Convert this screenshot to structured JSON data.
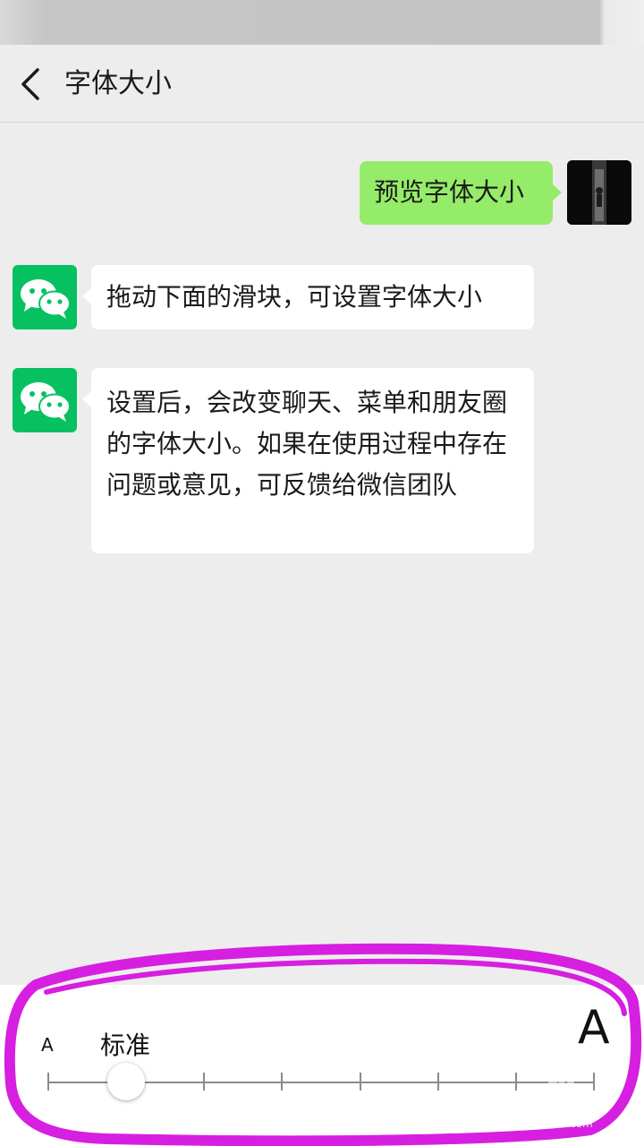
{
  "header": {
    "title": "字体大小",
    "back_icon": "chevron-left-icon"
  },
  "chat": {
    "user_message": "预览字体大小",
    "messages": [
      {
        "text": "拖动下面的滑块，可设置字体大小"
      },
      {
        "text": "设置后，会改变聊天、菜单和朋友圈的字体大小。如果在使用过程中存在问题或意见，可反馈给微信团队"
      }
    ]
  },
  "font_slider": {
    "small_label": "A",
    "large_label": "A",
    "current_label": "标准",
    "step_count": 8,
    "selected_step": 2
  },
  "watermark": {
    "text": "Bai百经验",
    "url": "jingyan.baidu.com"
  },
  "colors": {
    "sent_bubble": "#95ec69",
    "wechat_green": "#07c160",
    "annotation": "#d61fe0"
  }
}
